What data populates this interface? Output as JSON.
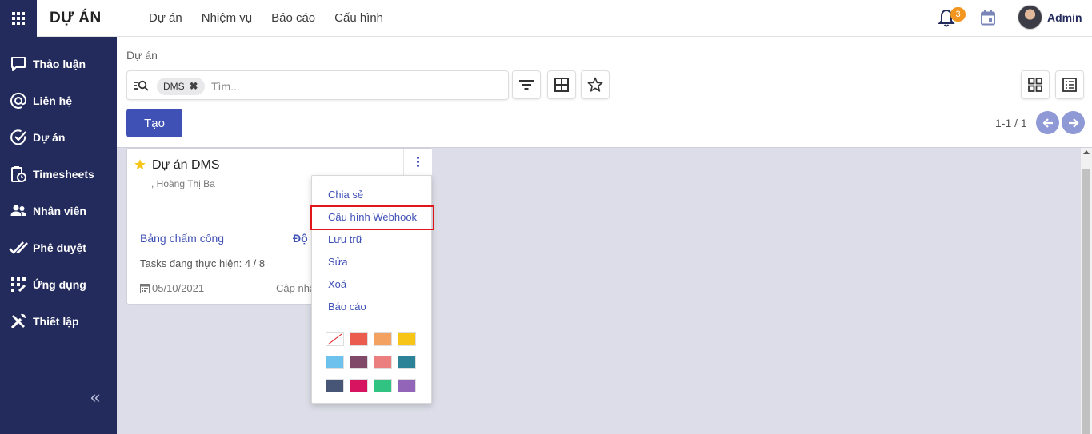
{
  "app": {
    "title": "DỰ ÁN",
    "apps_icon": "grid-icon"
  },
  "topnav": {
    "items": [
      "Dự án",
      "Nhiệm vụ",
      "Báo cáo",
      "Cấu hình"
    ]
  },
  "topbar": {
    "notification_count": "3",
    "username": "Admin"
  },
  "sidebar": {
    "items": [
      {
        "label": "Thảo luận",
        "icon": "chat-icon"
      },
      {
        "label": "Liên hệ",
        "icon": "at-icon"
      },
      {
        "label": "Dự án",
        "icon": "check-circle-icon"
      },
      {
        "label": "Timesheets",
        "icon": "clipboard-clock-icon"
      },
      {
        "label": "Nhân viên",
        "icon": "users-icon"
      },
      {
        "label": "Phê duyệt",
        "icon": "double-check-icon"
      },
      {
        "label": "Ứng dụng",
        "icon": "apps-icon"
      },
      {
        "label": "Thiết lập",
        "icon": "tools-icon"
      }
    ],
    "collapse_label": "«"
  },
  "breadcrumb": "Dự án",
  "search": {
    "chip": "DMS",
    "chip_remove": "✖",
    "placeholder": "Tìm..."
  },
  "toolbar": {
    "create_label": "Tạo",
    "pager": "1-1 / 1"
  },
  "card": {
    "title": "Dự án DMS",
    "subtitle": ", Hoàng Thị Ba",
    "link1": "Bảng chấm công",
    "link2": "Độ ư",
    "tasks": "Tasks đang thực hiện: 4 / 8",
    "date": "05/10/2021",
    "update": "Cập nhật"
  },
  "dropdown": {
    "items": [
      "Chia sẻ",
      "Cấu hình Webhook",
      "Lưu trữ",
      "Sửa",
      "Xoá",
      "Báo cáo"
    ],
    "highlighted": "Cấu hình Webhook",
    "colors": [
      "none",
      "#eb5b4e",
      "#f4a261",
      "#f6c517",
      "#6cc1ed",
      "#814968",
      "#eb7e7f",
      "#2c8397",
      "#475577",
      "#d6145f",
      "#30c381",
      "#9365b8"
    ]
  },
  "colors": {
    "sidebar": "#232b5c",
    "accent": "#3f51b5",
    "badge": "#f29620",
    "highlight": "#e0161b"
  }
}
